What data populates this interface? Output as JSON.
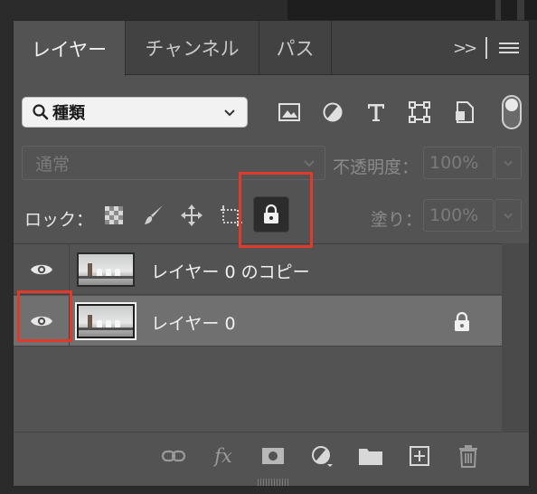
{
  "tabs": [
    {
      "label": "レイヤー",
      "active": true
    },
    {
      "label": "チャンネル",
      "active": false
    },
    {
      "label": "パス",
      "active": false
    }
  ],
  "tab_overflow": ">>",
  "filter": {
    "label": "種類",
    "icon": "search-icon"
  },
  "filter_icons": [
    "image-filter-icon",
    "adjustment-filter-icon",
    "type-filter-icon",
    "shape-filter-icon",
    "smart-object-filter-icon"
  ],
  "blend": {
    "mode": "通常"
  },
  "opacity": {
    "label": "不透明度：",
    "value": "100%"
  },
  "lock": {
    "label": "ロック：",
    "icons": [
      "lock-transparent-pixels-icon",
      "lock-image-pixels-icon",
      "lock-position-icon",
      "lock-artboard-icon",
      "lock-all-icon"
    ]
  },
  "fill": {
    "label": "塗り：",
    "value": "100%"
  },
  "layers": [
    {
      "name": "レイヤー 0 のコピー",
      "visible": true,
      "selected": false,
      "locked": false
    },
    {
      "name": "レイヤー 0",
      "visible": true,
      "selected": true,
      "locked": true
    }
  ],
  "bottom_icons": [
    "link-layers-icon",
    "fx-icon",
    "layer-mask-icon",
    "adjustment-layer-icon",
    "group-folder-icon",
    "new-layer-icon",
    "trash-icon"
  ],
  "fx_label": "fx",
  "colors": {
    "panel": "#535353",
    "tabbar": "#424242",
    "selected_row": "#707070",
    "highlight": "#e23a2a"
  }
}
